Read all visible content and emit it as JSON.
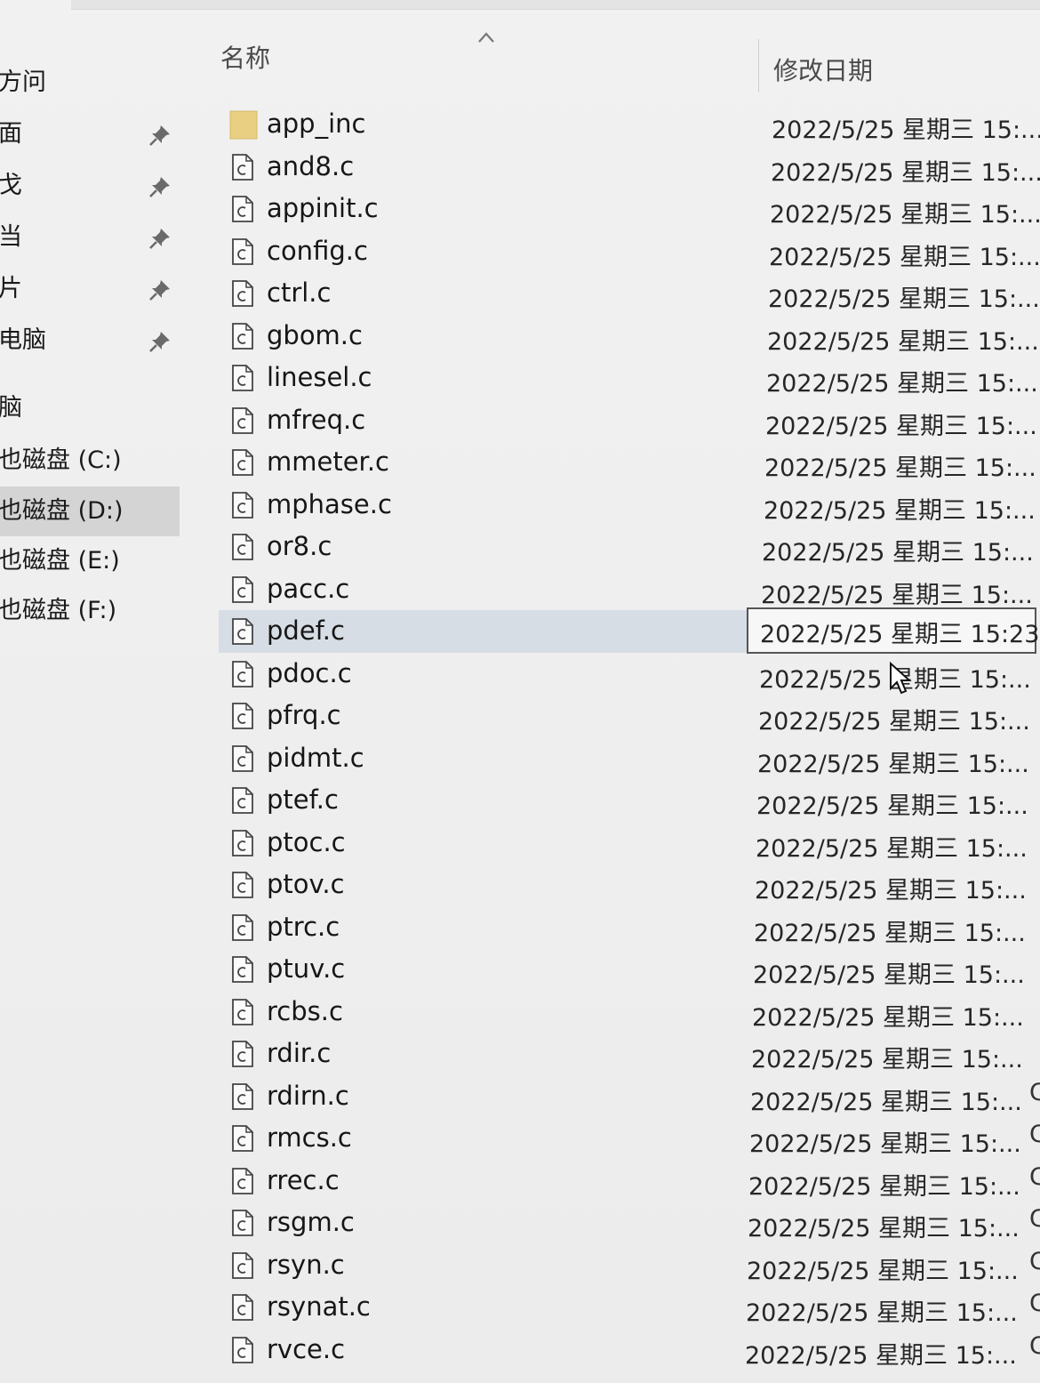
{
  "sidebar": {
    "items": [
      {
        "label": "方问",
        "pinned": false,
        "selected": false
      },
      {
        "label": "面",
        "pinned": true,
        "selected": false
      },
      {
        "label": "戈",
        "pinned": true,
        "selected": false
      },
      {
        "label": "当",
        "pinned": true,
        "selected": false
      },
      {
        "label": "片",
        "pinned": true,
        "selected": false
      },
      {
        "label": "电脑",
        "pinned": true,
        "selected": false
      },
      {
        "label": "脑",
        "pinned": false,
        "selected": false
      },
      {
        "label": "也磁盘 (C:)",
        "pinned": false,
        "selected": false
      },
      {
        "label": "也磁盘 (D:)",
        "pinned": false,
        "selected": true
      },
      {
        "label": "也磁盘 (E:)",
        "pinned": false,
        "selected": false
      },
      {
        "label": "也磁盘 (F:)",
        "pinned": false,
        "selected": false
      }
    ]
  },
  "header": {
    "name_label": "名称",
    "date_label": "修改日期",
    "sort_icon": "chevron-up-icon"
  },
  "files": [
    {
      "name": "app_inc",
      "type": "folder",
      "date": "2022/5/25 星期三 15:..."
    },
    {
      "name": "and8.c",
      "type": "c-file",
      "date": "2022/5/25 星期三 15:..."
    },
    {
      "name": "appinit.c",
      "type": "c-file",
      "date": "2022/5/25 星期三 15:..."
    },
    {
      "name": "config.c",
      "type": "c-file",
      "date": "2022/5/25 星期三 15:..."
    },
    {
      "name": "ctrl.c",
      "type": "c-file",
      "date": "2022/5/25 星期三 15:..."
    },
    {
      "name": "gbom.c",
      "type": "c-file",
      "date": "2022/5/25 星期三 15:..."
    },
    {
      "name": "linesel.c",
      "type": "c-file",
      "date": "2022/5/25 星期三 15:..."
    },
    {
      "name": "mfreq.c",
      "type": "c-file",
      "date": "2022/5/25 星期三 15:..."
    },
    {
      "name": "mmeter.c",
      "type": "c-file",
      "date": "2022/5/25 星期三 15:..."
    },
    {
      "name": "mphase.c",
      "type": "c-file",
      "date": "2022/5/25 星期三 15:..."
    },
    {
      "name": "or8.c",
      "type": "c-file",
      "date": "2022/5/25 星期三 15:..."
    },
    {
      "name": "pacc.c",
      "type": "c-file",
      "date": "2022/5/25 星期三 15:..."
    },
    {
      "name": "pdef.c",
      "type": "c-file",
      "date": "2022/5/25 星期三 15:23",
      "selected": true
    },
    {
      "name": "pdoc.c",
      "type": "c-file",
      "date": "2022/5/25 星期三 15:..."
    },
    {
      "name": "pfrq.c",
      "type": "c-file",
      "date": "2022/5/25 星期三 15:..."
    },
    {
      "name": "pidmt.c",
      "type": "c-file",
      "date": "2022/5/25 星期三 15:..."
    },
    {
      "name": "ptef.c",
      "type": "c-file",
      "date": "2022/5/25 星期三 15:..."
    },
    {
      "name": "ptoc.c",
      "type": "c-file",
      "date": "2022/5/25 星期三 15:..."
    },
    {
      "name": "ptov.c",
      "type": "c-file",
      "date": "2022/5/25 星期三 15:..."
    },
    {
      "name": "ptrc.c",
      "type": "c-file",
      "date": "2022/5/25 星期三 15:..."
    },
    {
      "name": "ptuv.c",
      "type": "c-file",
      "date": "2022/5/25 星期三 15:..."
    },
    {
      "name": "rcbs.c",
      "type": "c-file",
      "date": "2022/5/25 星期三 15:..."
    },
    {
      "name": "rdir.c",
      "type": "c-file",
      "date": "2022/5/25 星期三 15:..."
    },
    {
      "name": "rdirn.c",
      "type": "c-file",
      "date": "2022/5/25 星期三 15:..."
    },
    {
      "name": "rmcs.c",
      "type": "c-file",
      "date": "2022/5/25 星期三 15:..."
    },
    {
      "name": "rrec.c",
      "type": "c-file",
      "date": "2022/5/25 星期三 15:..."
    },
    {
      "name": "rsgm.c",
      "type": "c-file",
      "date": "2022/5/25 星期三 15:..."
    },
    {
      "name": "rsyn.c",
      "type": "c-file",
      "date": "2022/5/25 星期三 15:..."
    },
    {
      "name": "rsynat.c",
      "type": "c-file",
      "date": "2022/5/25 星期三 15:..."
    },
    {
      "name": "rvce.c",
      "type": "c-file",
      "date": "2022/5/25 星期三 15:..."
    }
  ],
  "row_edge_text": [
    "C",
    "C",
    "C",
    "C",
    "C",
    "C",
    "C"
  ],
  "icons": {
    "pin": "pin-icon",
    "folder": "folder-icon",
    "file": "c-file-icon",
    "cursor": "mouse-cursor-icon"
  },
  "colors": {
    "selected_sidebar": "#d4d4d4",
    "selected_row": "#d7dde5",
    "folder": "#e8cf82"
  }
}
